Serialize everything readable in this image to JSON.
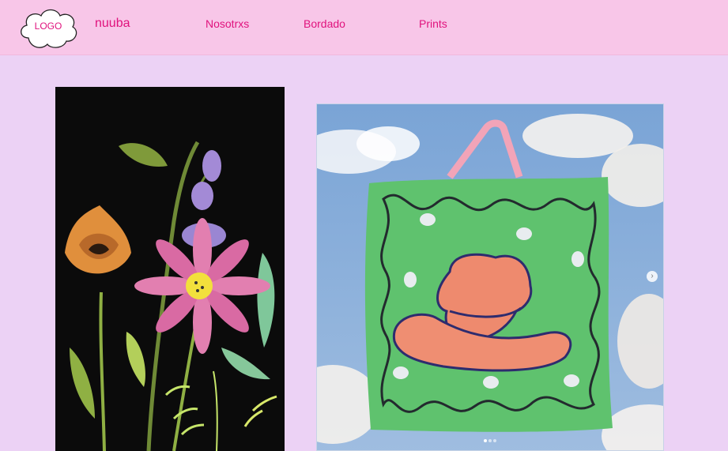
{
  "header": {
    "logo_text": "LOGO",
    "brand": "nuuba",
    "nav": [
      "Nosotrxs",
      "Bordado",
      "Prints"
    ]
  },
  "gallery": {
    "left_image": "flower-illustration",
    "right_image": "cowboy-hat-rug",
    "carousel_next": "›"
  },
  "colors": {
    "background": "#ecd2f5",
    "header_bg": "#f8c6e8",
    "accent": "#e0127d"
  }
}
